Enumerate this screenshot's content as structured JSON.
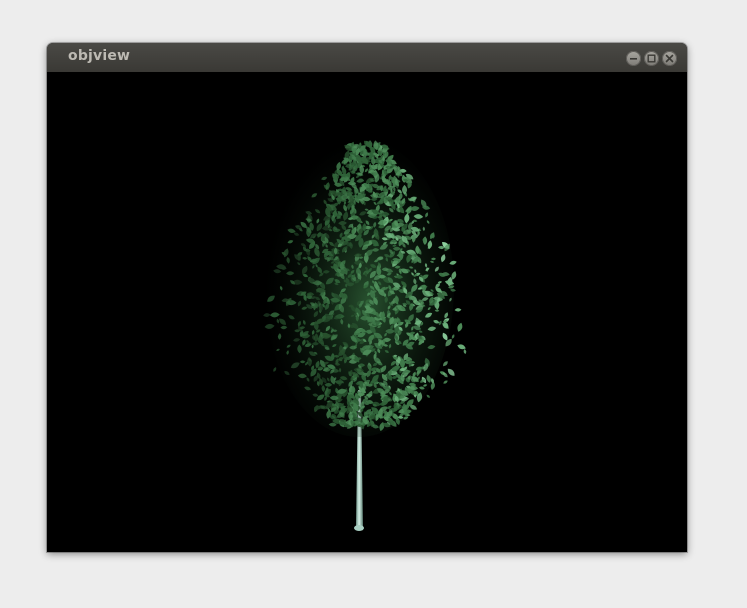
{
  "window": {
    "title": "objview",
    "controls": [
      {
        "name": "minimize-button",
        "icon": "minimize-icon"
      },
      {
        "name": "maximize-button",
        "icon": "maximize-icon"
      },
      {
        "name": "close-button",
        "icon": "close-icon"
      }
    ]
  },
  "viewport": {
    "background": "#000000",
    "scene": "tree-model"
  },
  "colors": {
    "titlebar": "#3f3e3a",
    "title_text": "#bdbab3",
    "desktop": "#ededed",
    "foliage_dark": "#1f3d24",
    "foliage_mid": "#3f7a4a",
    "foliage_light": "#8fd3a0",
    "trunk": "#bfe2d6"
  }
}
